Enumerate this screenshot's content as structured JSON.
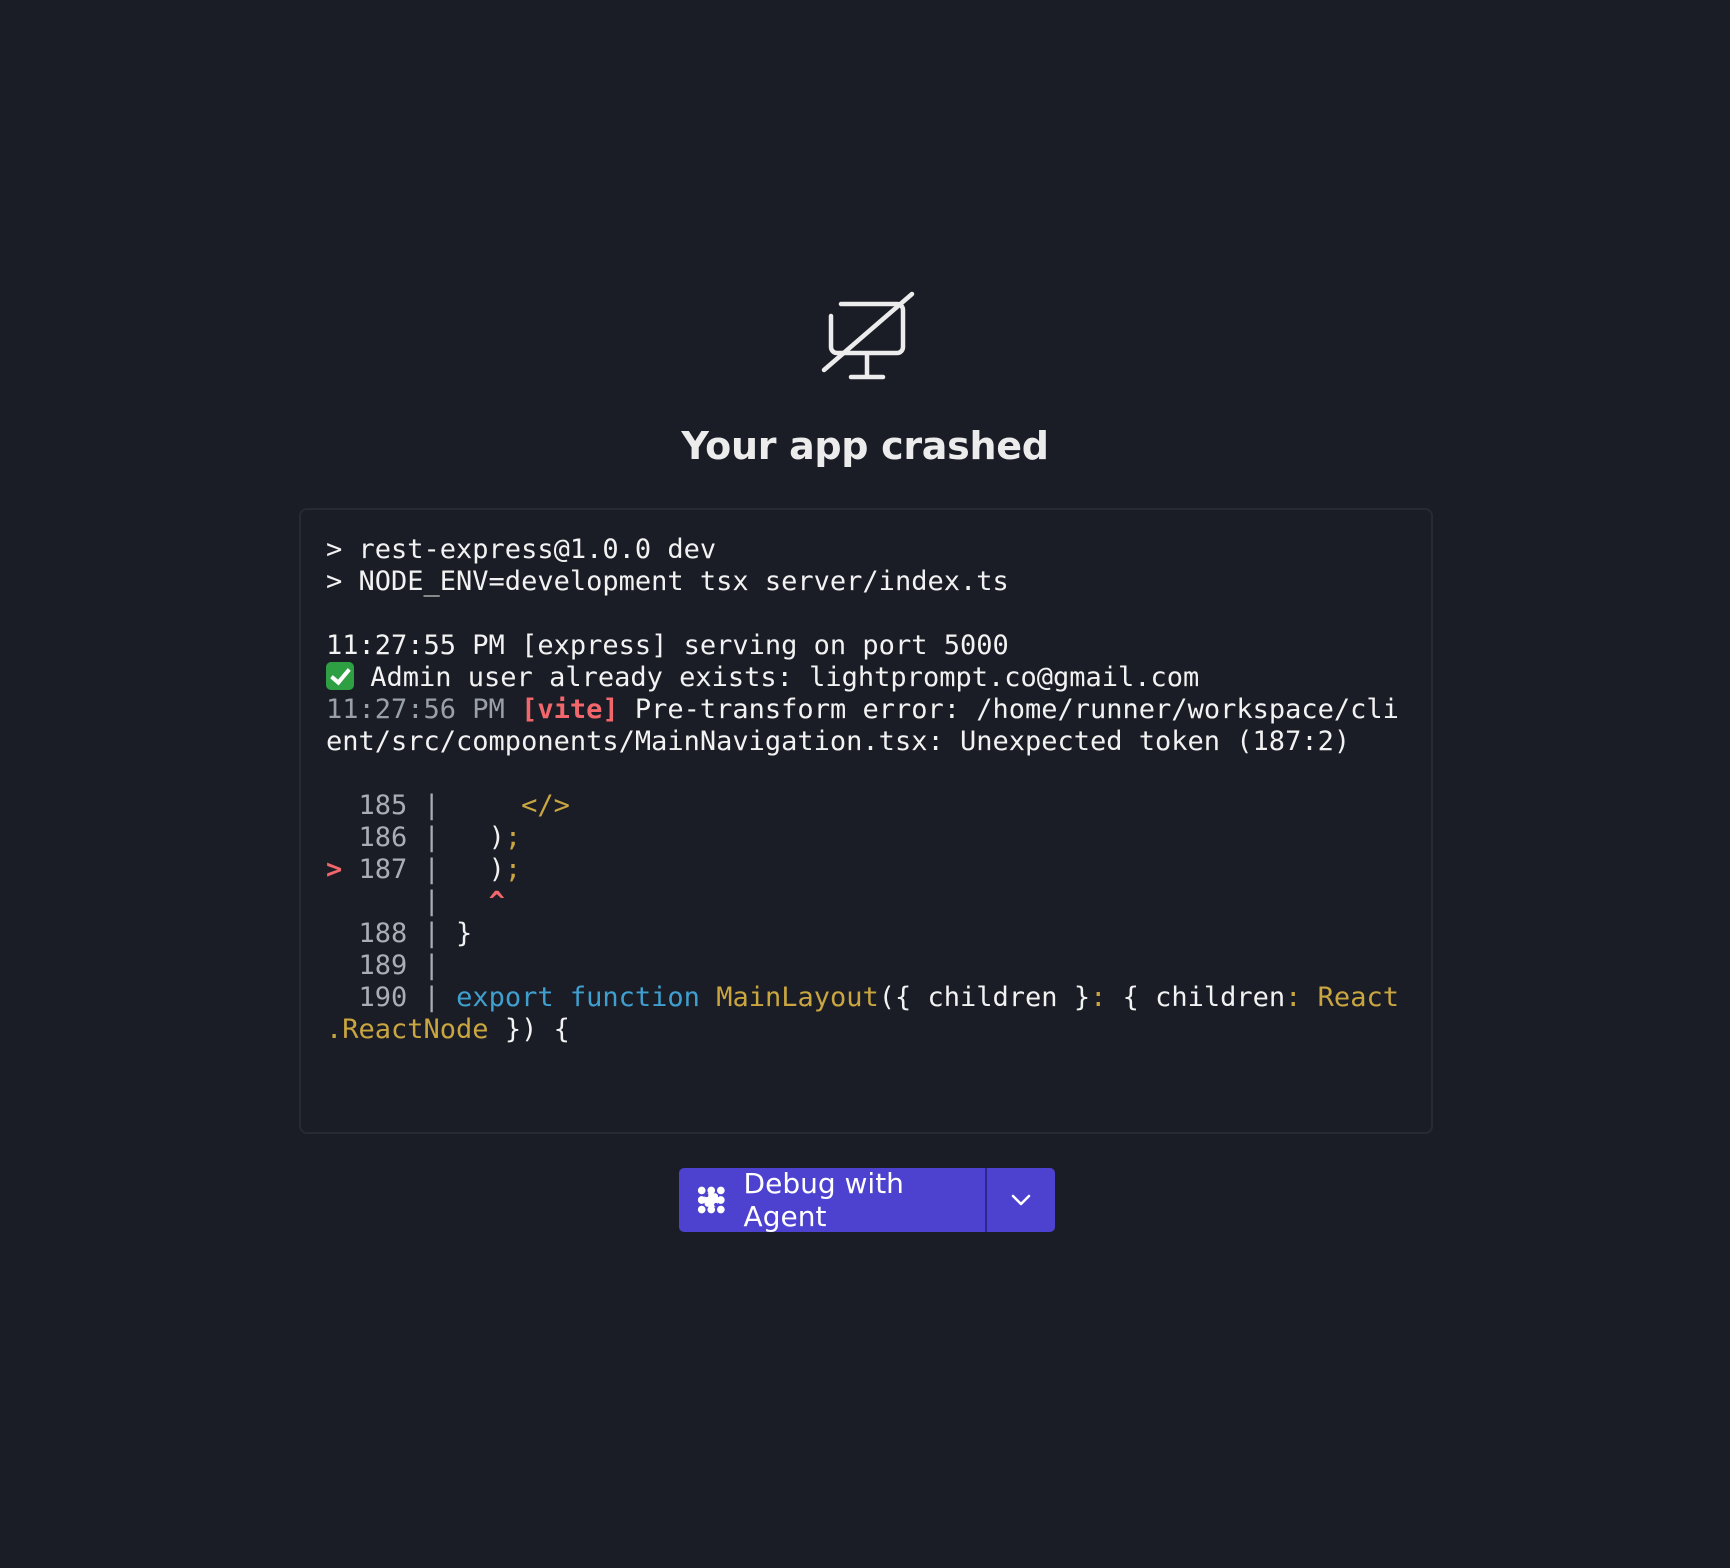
{
  "crash": {
    "icon": "monitor-off-icon",
    "title": "Your app crashed"
  },
  "log": {
    "cmd1": "> rest-express@1.0.0 dev",
    "cmd2": "> NODE_ENV=development tsx server/index.ts",
    "serving": "11:27:55 PM [express] serving on port 5000",
    "admin": " Admin user already exists: lightprompt.co@gmail.com",
    "vite_time": "11:27:56 PM",
    "vite_tag": "[vite]",
    "vite_msg1": " Pre-transform error: /home/runner/workspace/cli",
    "vite_msg2": "ent/src/components/MainNavigation.tsx: Unexpected token (187:2)",
    "code": {
      "l185_num": "  185 |",
      "l185_code": "</>",
      "l186_num": "  186 |",
      "l186_paren": ")",
      "l186_semi": ";",
      "l187_marker": ">",
      "l187_num": " 187 |",
      "l187_paren": ")",
      "l187_semi": ";",
      "caret_bar": "      |",
      "caret": "^",
      "l188_num": "  188 |",
      "l188_code": " }",
      "l189_num": "  189 |",
      "l190_num": "  190 |",
      "l190_export": "export",
      "l190_function": "function",
      "l190_name": "MainLayout",
      "l190_args1": "({ children }",
      "l190_colon1": ":",
      "l190_args2": " { children",
      "l190_colon2": ":",
      "l190_react": " React",
      "l190_reactnode": ".ReactNode",
      "l190_end": " }) {"
    },
    "success_icon": "check-icon"
  },
  "actions": {
    "debug_label": "Debug with Agent",
    "debug_icon": "agent-icon",
    "dropdown_icon": "chevron-down-icon"
  },
  "colors": {
    "background": "#1b1d26",
    "button": "#4d41cf",
    "error": "#f2676b",
    "keyword": "#3f9fcf",
    "accent": "#c9a640"
  }
}
